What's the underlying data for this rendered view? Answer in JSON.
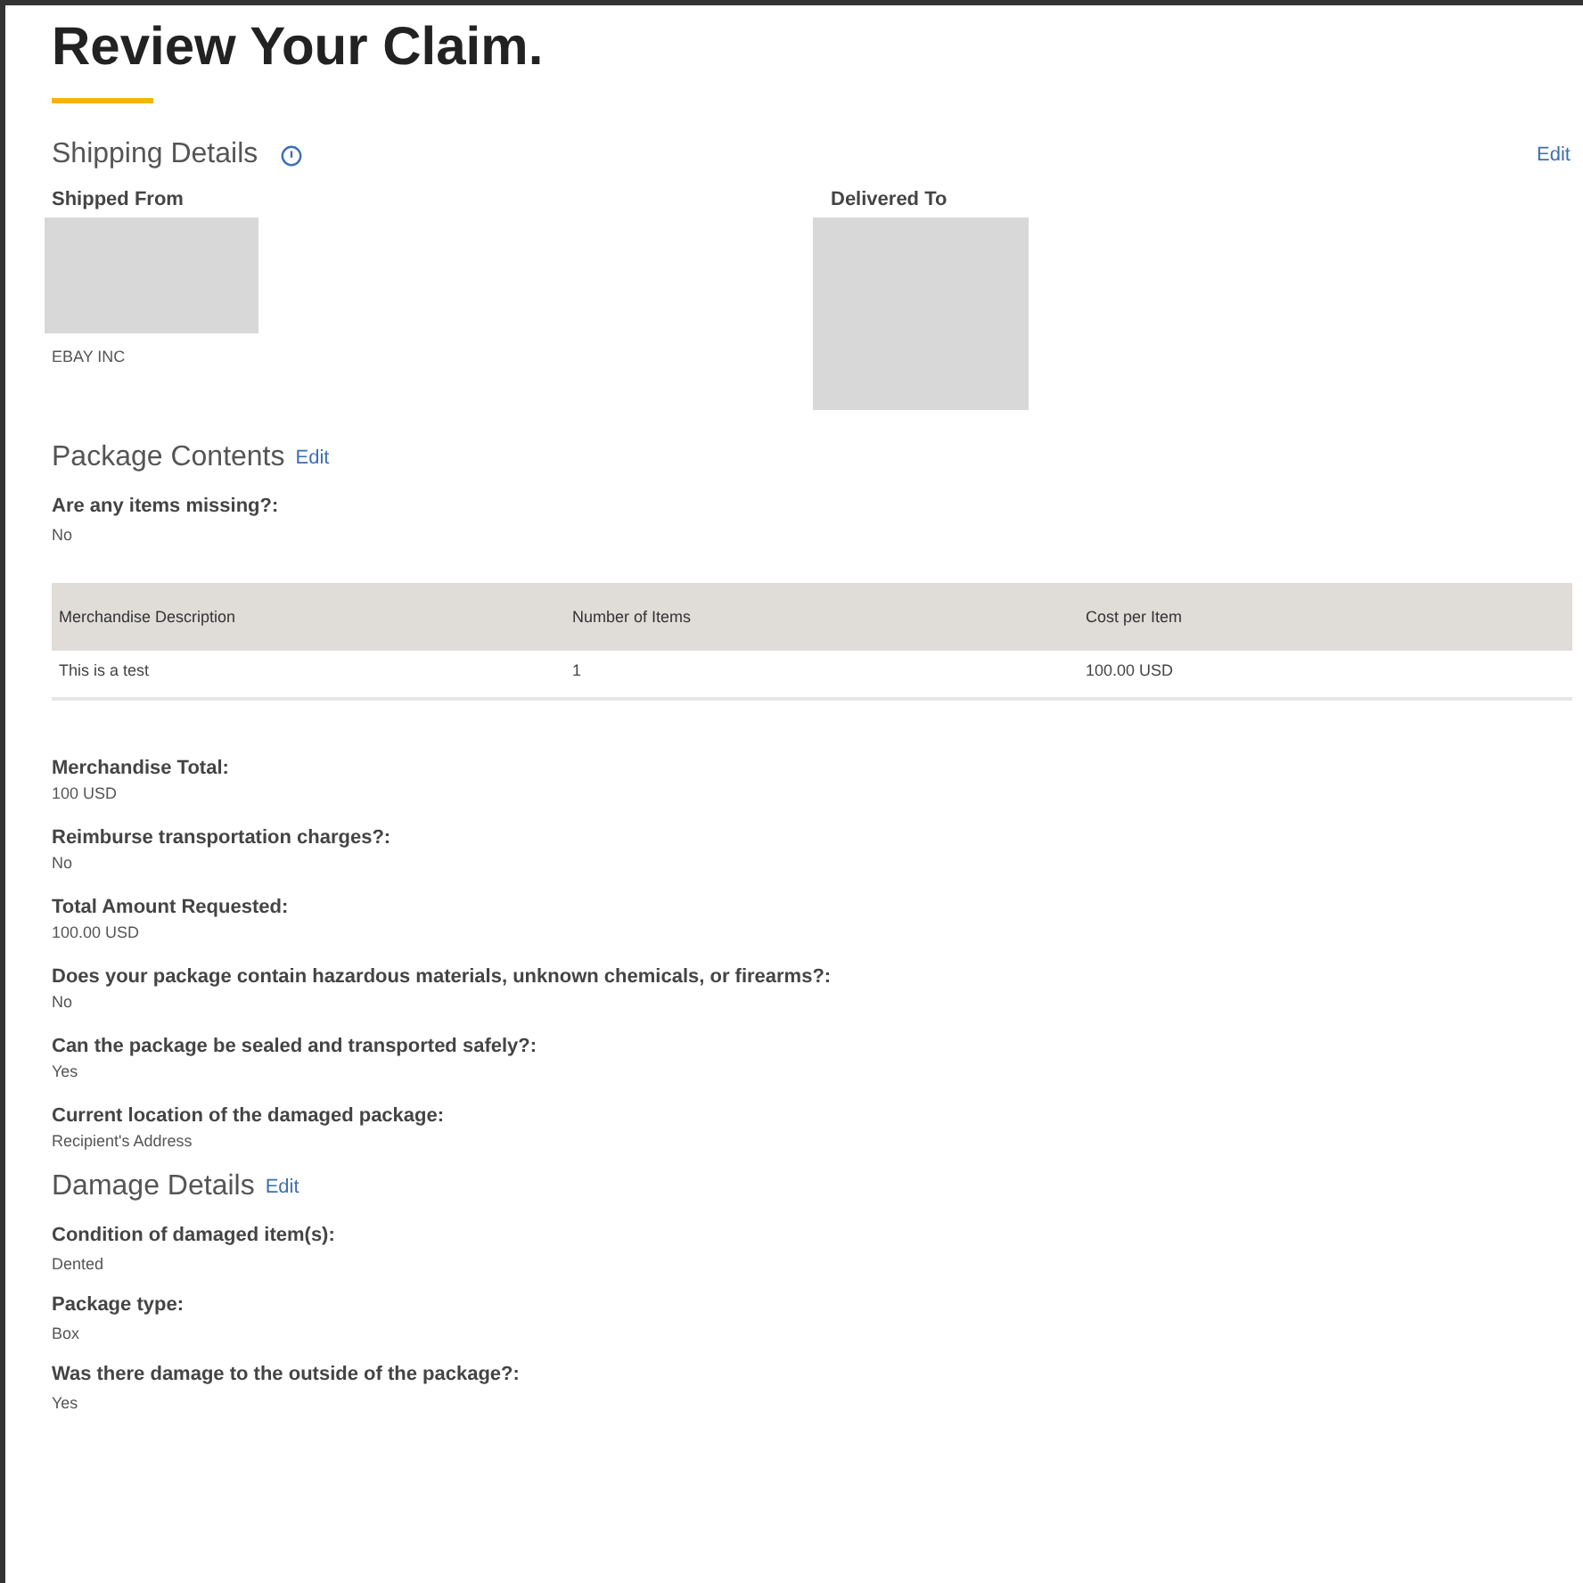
{
  "title": "Review Your Claim.",
  "shipping": {
    "heading": "Shipping Details",
    "edit": "Edit",
    "from_label": "Shipped From",
    "from_value": "EBAY INC",
    "to_label": "Delivered To"
  },
  "package": {
    "heading": "Package Contents",
    "edit": "Edit",
    "fields": [
      {
        "label": "Are any items missing?:",
        "value": "No"
      }
    ],
    "table": {
      "columns": [
        "Merchandise Description",
        "Number of Items",
        "Cost per Item"
      ],
      "rows": [
        [
          "This is a test",
          "1",
          "100.00 USD"
        ]
      ]
    },
    "fields_after": [
      {
        "label": "Merchandise Total:",
        "value": "100 USD"
      },
      {
        "label": "Reimburse transportation charges?:",
        "value": "No"
      },
      {
        "label": "Total Amount Requested:",
        "value": "100.00 USD"
      },
      {
        "label": "Does your package contain hazardous materials, unknown chemicals, or firearms?:",
        "value": "No"
      },
      {
        "label": "Can the package be sealed and transported safely?:",
        "value": "Yes"
      },
      {
        "label": "Current location of the damaged package:",
        "value": "Recipient's Address"
      }
    ]
  },
  "damage": {
    "heading": "Damage Details",
    "edit": "Edit",
    "fields": [
      {
        "label": "Condition of damaged item(s):",
        "value": "Dented"
      },
      {
        "label": "Package type:",
        "value": "Box"
      },
      {
        "label": "Was there damage to the outside of the package?:",
        "value": "Yes"
      }
    ]
  }
}
